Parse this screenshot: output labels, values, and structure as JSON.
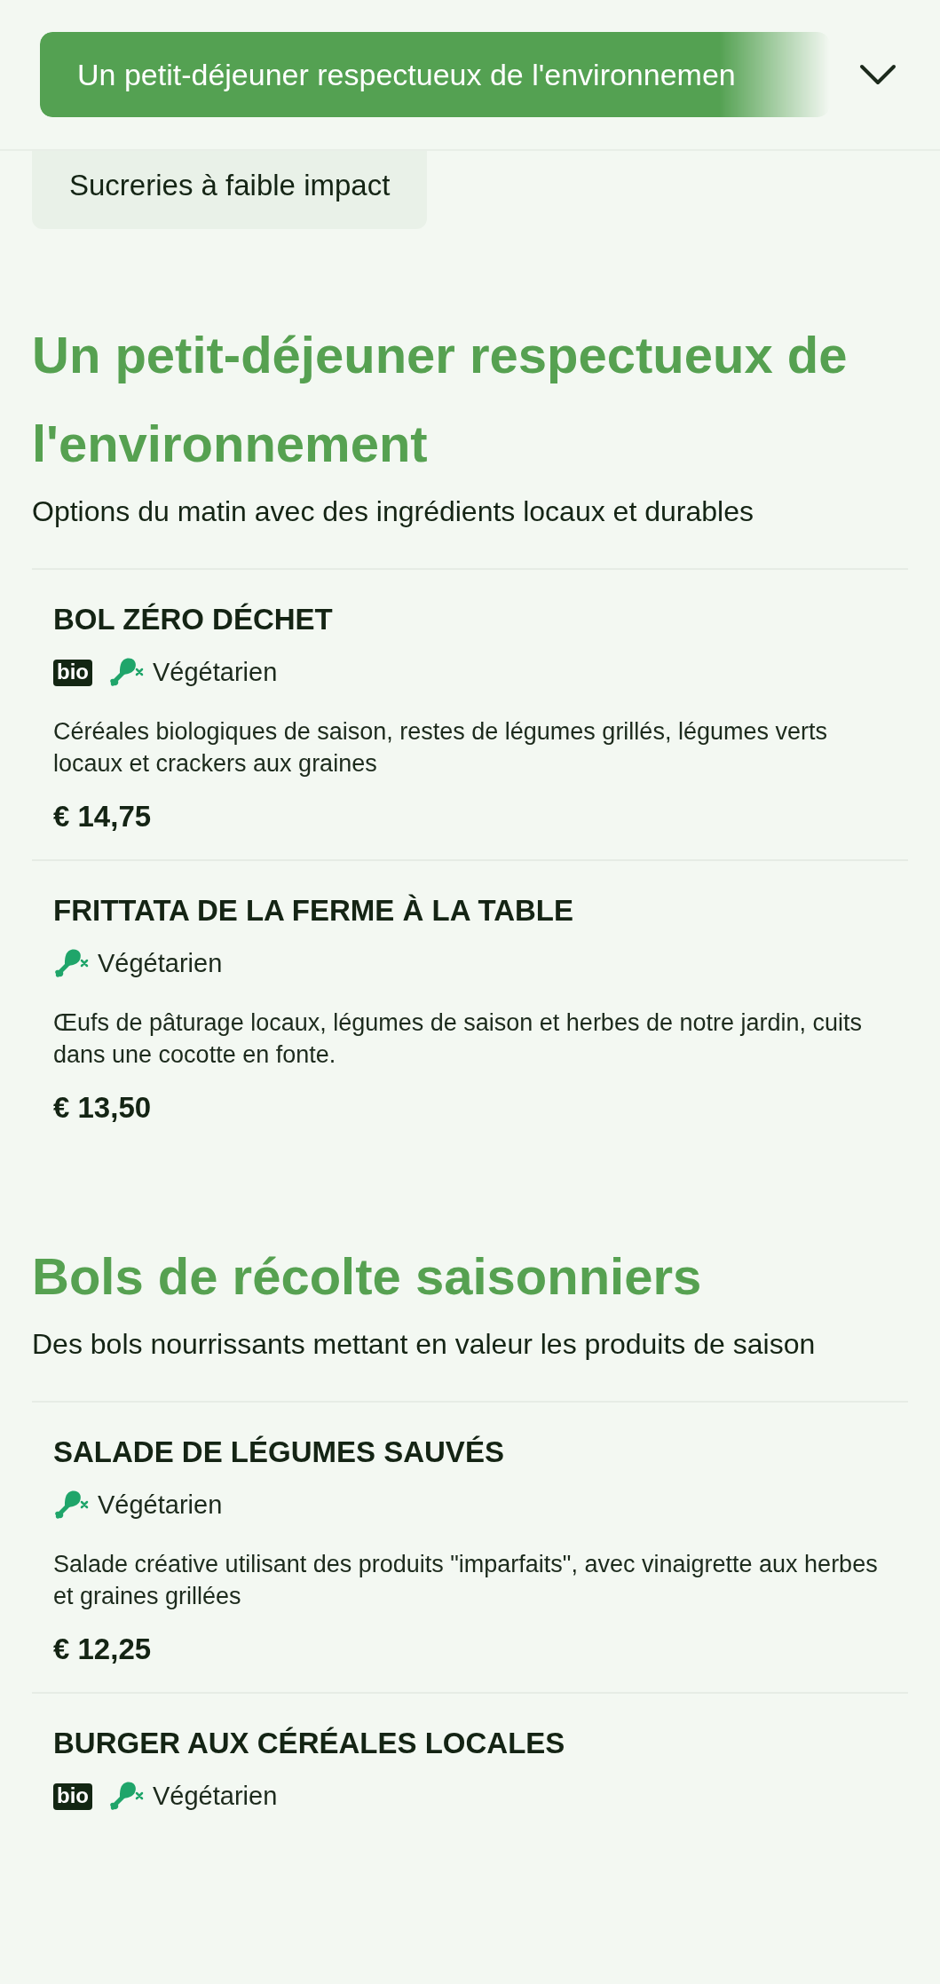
{
  "nav": {
    "current": "Un petit-déjeuner respectueux de l'environnemen"
  },
  "category_chip": "Sucreries à faible impact",
  "sections": [
    {
      "title": "Un petit-déjeuner respectueux de l'environnement",
      "subtitle": "Options du matin avec des ingrédients locaux et durables",
      "items": [
        {
          "name": "BOL ZÉRO DÉCHET",
          "tags": [
            {
              "kind": "bio",
              "label": "bio"
            },
            {
              "kind": "vegetarian",
              "label": "Végétarien"
            }
          ],
          "description": "Céréales biologiques de saison, restes de légumes grillés, légumes verts locaux et crackers aux graines",
          "price": "€ 14,75"
        },
        {
          "name": "FRITTATA DE LA FERME À LA TABLE",
          "tags": [
            {
              "kind": "vegetarian",
              "label": "Végétarien"
            }
          ],
          "description": "Œufs de pâturage locaux, légumes de saison et herbes de notre jardin, cuits dans une cocotte en fonte.",
          "price": "€ 13,50"
        }
      ]
    },
    {
      "title": "Bols de récolte saisonniers",
      "subtitle": "Des bols nourrissants mettant en valeur les produits de saison",
      "items": [
        {
          "name": "SALADE DE LÉGUMES SAUVÉS",
          "tags": [
            {
              "kind": "vegetarian",
              "label": "Végétarien"
            }
          ],
          "description": "Salade créative utilisant des produits \"imparfaits\", avec vinaigrette aux herbes et graines grillées",
          "price": "€ 12,25"
        },
        {
          "name": "BURGER AUX CÉRÉALES LOCALES",
          "tags": [
            {
              "kind": "bio",
              "label": "bio"
            },
            {
              "kind": "vegetarian",
              "label": "Végétarien"
            }
          ]
        }
      ]
    }
  ]
}
